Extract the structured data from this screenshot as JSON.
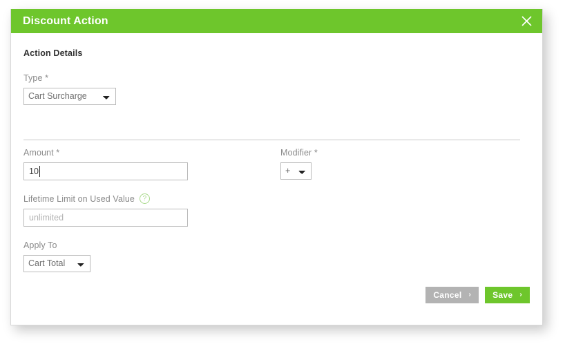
{
  "modal": {
    "title": "Discount Action",
    "close_icon": "close-icon",
    "header_color": "#6ec62c"
  },
  "body": {
    "section_heading": "Action Details",
    "fields": {
      "type": {
        "label": "Type *",
        "value": "Cart Surcharge",
        "options": [
          "Cart Surcharge"
        ]
      },
      "amount": {
        "label": "Amount *",
        "value": "10",
        "placeholder": ""
      },
      "modifier": {
        "label": "Modifier *",
        "value": "+",
        "options": [
          "+"
        ]
      },
      "lifetime_limit": {
        "label": "Lifetime Limit on Used Value",
        "help_icon": "?",
        "value": "",
        "placeholder": "unlimited"
      },
      "apply_to": {
        "label": "Apply To",
        "value": "Cart Total",
        "options": [
          "Cart Total"
        ]
      }
    }
  },
  "actions": {
    "cancel_label": "Cancel",
    "cancel_chevron": "›",
    "cancel_color": "#b3b3b3",
    "save_label": "Save",
    "save_chevron": "›",
    "save_color": "#6ec62c"
  }
}
